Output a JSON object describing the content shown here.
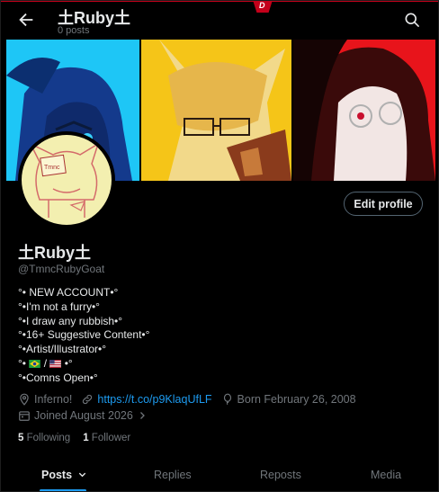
{
  "header": {
    "title": "土Ruby土",
    "posts_count": "0 posts"
  },
  "profile": {
    "name": "土Ruby土",
    "handle": "@TmncRubyGoat",
    "edit_button": "Edit profile",
    "avatar_text": "Tmnc",
    "bio_lines": [
      "°• NEW ACCOUNT•°",
      "°•I'm not a furry•°",
      "°•I draw any rubbish•°",
      "°•16+ Suggestive Content•°",
      "°•Artist/Illustrator•°",
      "°•",
      "°•Comns Open•°"
    ],
    "bio_flag_line_prefix": "°•",
    "bio_flag_sep": "/",
    "bio_flag_line_suffix": "•°",
    "location": "Inferno!",
    "link": "https://t.co/p9KlaqUfLF",
    "born": "Born February 26, 2008",
    "joined": "Joined August 2026",
    "following_count": "5",
    "following_label": "Following",
    "followers_count": "1",
    "followers_label": "Follower"
  },
  "tabs": [
    {
      "label": "Posts",
      "active": true
    },
    {
      "label": "Replies",
      "active": false
    },
    {
      "label": "Reposts",
      "active": false
    },
    {
      "label": "Media",
      "active": false
    }
  ],
  "colors": {
    "accent": "#1d9bf0",
    "muted": "#71767b",
    "banner_blue": "#1ec6f6",
    "banner_yellow": "#f5c518",
    "banner_red": "#e8141b",
    "top_badge": "#c3001a"
  },
  "icons": [
    "back-arrow-icon",
    "search-icon",
    "location-pin-icon",
    "link-icon",
    "balloon-icon",
    "calendar-icon",
    "chevron-right-icon",
    "chevron-down-icon"
  ]
}
